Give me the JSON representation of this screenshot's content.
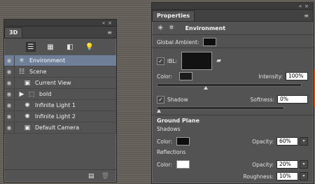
{
  "panel3d": {
    "tab_label": "3D",
    "layers": [
      {
        "label": "Environment",
        "icon": "environment-icon",
        "eye": true,
        "selected": true
      },
      {
        "label": "Scene",
        "icon": "scene-icon",
        "eye": true
      },
      {
        "label": "Current View",
        "icon": "camera-icon",
        "eye": true
      },
      {
        "label": "bold",
        "icon": "mesh-icon",
        "eye": true
      },
      {
        "label": "Infinite Light 1",
        "icon": "light-icon",
        "eye": true
      },
      {
        "label": "Infinite Light 2",
        "icon": "light-icon",
        "eye": true
      },
      {
        "label": "Default Camera",
        "icon": "camera-icon",
        "eye": true
      }
    ]
  },
  "properties": {
    "tab_label": "Properties",
    "header": "Environment",
    "global_ambient_label": "Global Ambient:",
    "ibl_label": "IBL:",
    "color_label": "Color:",
    "intensity_label": "Intensity:",
    "intensity_value": "100%",
    "shadow_label": "Shadow",
    "softness_label": "Softness:",
    "softness_value": "0%",
    "ground_plane_label": "Ground Plane",
    "shadows_label": "Shadows",
    "shadows_color_label": "Color:",
    "shadows_opacity_label": "Opacity:",
    "shadows_opacity_value": "60%",
    "reflections_label": "Reflections",
    "reflections_color_label": "Color:",
    "reflections_opacity_label": "Opacity:",
    "reflections_opacity_value": "20%",
    "roughness_label": "Roughness:",
    "roughness_value": "10%"
  }
}
